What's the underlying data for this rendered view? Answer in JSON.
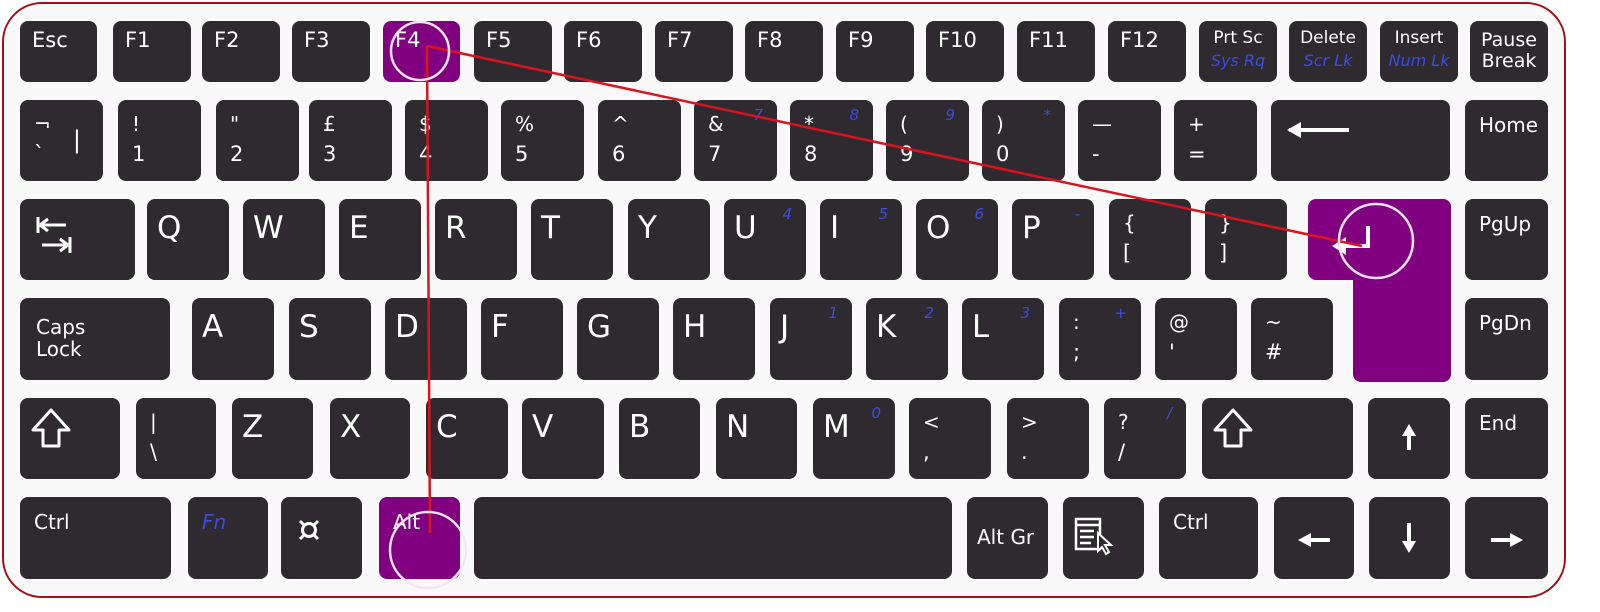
{
  "colors": {
    "key": "#2e2a2f",
    "highlight": "#800080",
    "secondary_legend": "#3a4ee0",
    "annotation_line": "#d9141e",
    "frame_border": "#a3101a"
  },
  "keyboard": {
    "highlighted_keys": [
      "F4",
      "Enter",
      "Alt"
    ],
    "rows": [
      {
        "keys": [
          {
            "name": "key-esc",
            "top": "Esc"
          },
          {
            "name": "key-f1",
            "top": "F1"
          },
          {
            "name": "key-f2",
            "top": "F2"
          },
          {
            "name": "key-f3",
            "top": "F3"
          },
          {
            "name": "key-f4",
            "top": "F4",
            "highlighted": true
          },
          {
            "name": "key-f5",
            "top": "F5"
          },
          {
            "name": "key-f6",
            "top": "F6"
          },
          {
            "name": "key-f7",
            "top": "F7"
          },
          {
            "name": "key-f8",
            "top": "F8"
          },
          {
            "name": "key-f9",
            "top": "F9"
          },
          {
            "name": "key-f10",
            "top": "F10"
          },
          {
            "name": "key-f11",
            "top": "F11"
          },
          {
            "name": "key-f12",
            "top": "F12"
          },
          {
            "name": "key-prtsc",
            "top": "Prt Sc",
            "bottom": "Sys Rq"
          },
          {
            "name": "key-delete",
            "top": "Delete",
            "bottom": "Scr Lk"
          },
          {
            "name": "key-insert",
            "top": "Insert",
            "bottom": "Num Lk"
          },
          {
            "name": "key-pause",
            "top": "Pause",
            "bottom": "Break"
          }
        ]
      },
      {
        "keys": [
          {
            "name": "key-backtick",
            "top": "¬",
            "bottom": "`",
            "right": "|"
          },
          {
            "name": "key-1",
            "top": "!",
            "bottom": "1"
          },
          {
            "name": "key-2",
            "top": "\"",
            "bottom": "2"
          },
          {
            "name": "key-3",
            "top": "£",
            "bottom": "3"
          },
          {
            "name": "key-4",
            "top": "$",
            "bottom": "4"
          },
          {
            "name": "key-5",
            "top": "%",
            "bottom": "5"
          },
          {
            "name": "key-6",
            "top": "^",
            "bottom": "6"
          },
          {
            "name": "key-7",
            "top": "&",
            "bottom": "7",
            "alt": "7"
          },
          {
            "name": "key-8",
            "top": "*",
            "bottom": "8",
            "alt": "8"
          },
          {
            "name": "key-9",
            "top": "(",
            "bottom": "9",
            "alt": "9"
          },
          {
            "name": "key-0",
            "top": ")",
            "bottom": "0",
            "alt": "*"
          },
          {
            "name": "key-minus",
            "top": "—",
            "bottom": "-"
          },
          {
            "name": "key-equals",
            "top": "+",
            "bottom": "="
          },
          {
            "name": "key-backspace",
            "icon": "backspace-arrow-icon"
          },
          {
            "name": "key-home",
            "top": "Home"
          }
        ]
      },
      {
        "keys": [
          {
            "name": "key-tab",
            "icon": "tab-arrows-icon"
          },
          {
            "name": "key-q",
            "top": "Q"
          },
          {
            "name": "key-w",
            "top": "W"
          },
          {
            "name": "key-e",
            "top": "E"
          },
          {
            "name": "key-r",
            "top": "R"
          },
          {
            "name": "key-t",
            "top": "T"
          },
          {
            "name": "key-y",
            "top": "Y"
          },
          {
            "name": "key-u",
            "top": "U",
            "alt": "4"
          },
          {
            "name": "key-i",
            "top": "I",
            "alt": "5"
          },
          {
            "name": "key-o",
            "top": "O",
            "alt": "6"
          },
          {
            "name": "key-p",
            "top": "P",
            "alt": "-"
          },
          {
            "name": "key-left-bracket",
            "top": "{",
            "bottom": "["
          },
          {
            "name": "key-right-bracket",
            "top": "}",
            "bottom": "]"
          },
          {
            "name": "key-enter",
            "icon": "enter-return-icon",
            "highlighted": true
          },
          {
            "name": "key-pgup",
            "top": "PgUp"
          }
        ]
      },
      {
        "keys": [
          {
            "name": "key-caps-lock",
            "top": "Caps",
            "bottom": "Lock"
          },
          {
            "name": "key-a",
            "top": "A"
          },
          {
            "name": "key-s",
            "top": "S"
          },
          {
            "name": "key-d",
            "top": "D"
          },
          {
            "name": "key-f",
            "top": "F"
          },
          {
            "name": "key-g",
            "top": "G"
          },
          {
            "name": "key-h",
            "top": "H"
          },
          {
            "name": "key-j",
            "top": "J",
            "alt": "1"
          },
          {
            "name": "key-k",
            "top": "K",
            "alt": "2"
          },
          {
            "name": "key-l",
            "top": "L",
            "alt": "3"
          },
          {
            "name": "key-semicolon",
            "top": ":",
            "bottom": ";",
            "alt": "+"
          },
          {
            "name": "key-quote",
            "top": "@",
            "bottom": "'"
          },
          {
            "name": "key-hash",
            "top": "~",
            "bottom": "#"
          },
          {
            "name": "key-pgdn",
            "top": "PgDn"
          }
        ]
      },
      {
        "keys": [
          {
            "name": "key-left-shift",
            "icon": "shift-arrow-icon"
          },
          {
            "name": "key-backslash",
            "top": "|",
            "bottom": "\\"
          },
          {
            "name": "key-z",
            "top": "Z"
          },
          {
            "name": "key-x",
            "top": "X"
          },
          {
            "name": "key-c",
            "top": "C"
          },
          {
            "name": "key-v",
            "top": "V"
          },
          {
            "name": "key-b",
            "top": "B"
          },
          {
            "name": "key-n",
            "top": "N"
          },
          {
            "name": "key-m",
            "top": "M",
            "alt": "0"
          },
          {
            "name": "key-comma",
            "top": "<",
            "bottom": ","
          },
          {
            "name": "key-period",
            "top": ">",
            "bottom": "."
          },
          {
            "name": "key-slash",
            "top": "?",
            "bottom": "/",
            "alt": "/"
          },
          {
            "name": "key-right-shift",
            "icon": "shift-arrow-icon"
          },
          {
            "name": "key-up",
            "icon": "arrow-up-icon"
          },
          {
            "name": "key-end",
            "top": "End"
          }
        ]
      },
      {
        "keys": [
          {
            "name": "key-left-ctrl",
            "top": "Ctrl"
          },
          {
            "name": "key-fn",
            "top": "Fn"
          },
          {
            "name": "key-windows",
            "icon": "currency-sign-icon"
          },
          {
            "name": "key-alt",
            "top": "Alt",
            "highlighted": true
          },
          {
            "name": "key-space"
          },
          {
            "name": "key-alt-gr",
            "top": "Alt Gr"
          },
          {
            "name": "key-menu",
            "icon": "context-menu-icon"
          },
          {
            "name": "key-right-ctrl",
            "top": "Ctrl"
          },
          {
            "name": "key-left",
            "icon": "arrow-left-icon"
          },
          {
            "name": "key-down",
            "icon": "arrow-down-icon"
          },
          {
            "name": "key-right",
            "icon": "arrow-right-icon"
          }
        ]
      }
    ]
  },
  "annotations": {
    "connections": [
      [
        "F4",
        "Enter"
      ],
      [
        "F4",
        "Alt"
      ]
    ],
    "circled_keys": [
      "F4",
      "Enter",
      "Alt"
    ]
  }
}
